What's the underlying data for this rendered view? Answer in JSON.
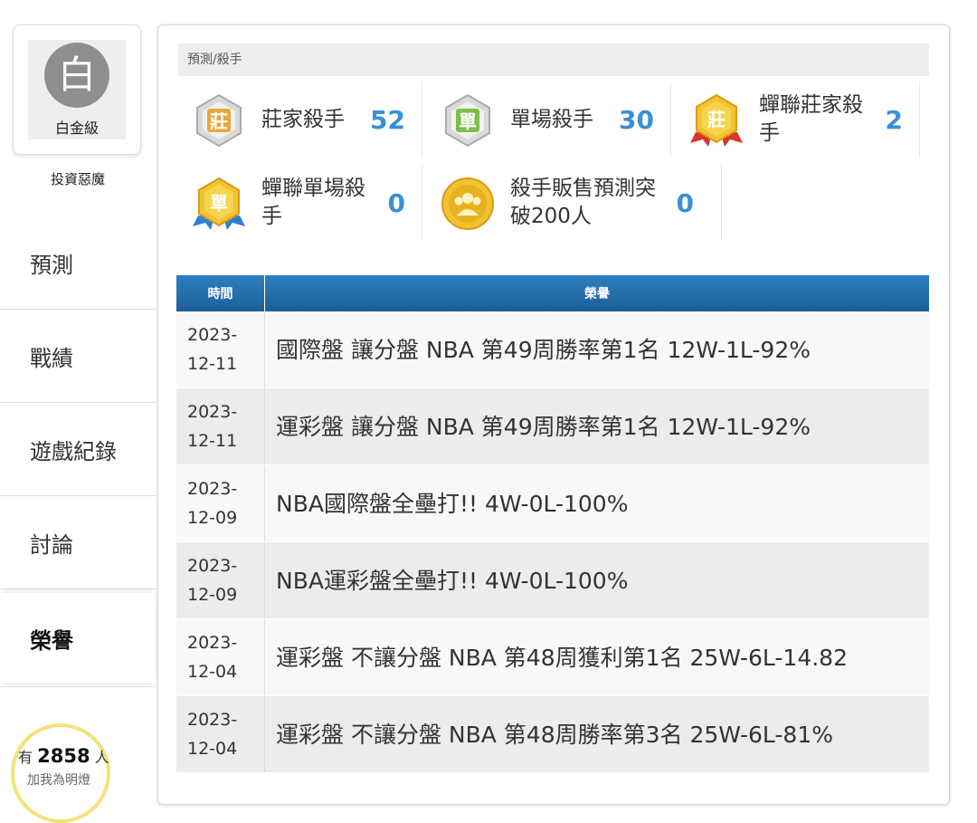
{
  "sidebar": {
    "avatar_char": "白",
    "level": "白金級",
    "nickname": "投資惡魔",
    "nav": [
      {
        "label": "預測"
      },
      {
        "label": "戰績"
      },
      {
        "label": "遊戲紀錄"
      },
      {
        "label": "討論"
      },
      {
        "label": "榮譽"
      }
    ],
    "active_index": 4,
    "fans": {
      "prefix": "有",
      "count": "2858",
      "suffix": "人",
      "hint": "加我為明燈"
    }
  },
  "main": {
    "breadcrumb": "預測/殺手",
    "badges": [
      {
        "label": "莊家殺手",
        "count": "52",
        "icon": "zhuang-badge-icon",
        "glyph": "莊"
      },
      {
        "label": "單場殺手",
        "count": "30",
        "icon": "dan-badge-icon",
        "glyph": "單"
      },
      {
        "label": "蟬聯莊家殺手",
        "count": "2",
        "icon": "consecutive-zhuang-badge-icon",
        "glyph": "莊"
      },
      {
        "label": "蟬聯單場殺手",
        "count": "0",
        "icon": "consecutive-dan-badge-icon",
        "glyph": "單"
      },
      {
        "label": "殺手販售預測突破200人",
        "count": "0",
        "icon": "sales-medal-icon",
        "glyph": ""
      }
    ],
    "table": {
      "headers": {
        "time": "時間",
        "honor": "榮譽"
      },
      "rows": [
        {
          "date": "2023-12-11",
          "text": "國際盤 讓分盤 NBA 第49周勝率第1名 12W-1L-92%"
        },
        {
          "date": "2023-12-11",
          "text": "運彩盤 讓分盤 NBA 第49周勝率第1名 12W-1L-92%"
        },
        {
          "date": "2023-12-09",
          "text": "NBA國際盤全壘打!! 4W-0L-100%"
        },
        {
          "date": "2023-12-09",
          "text": "NBA運彩盤全壘打!! 4W-0L-100%"
        },
        {
          "date": "2023-12-04",
          "text": "運彩盤 不讓分盤 NBA 第48周獲利第1名 25W-6L-14.82"
        },
        {
          "date": "2023-12-04",
          "text": "運彩盤 不讓分盤 NBA 第48周勝率第3名 25W-6L-81%"
        }
      ]
    }
  },
  "colors": {
    "accent": "#3a8fd6",
    "header": "#2e7fc0"
  }
}
